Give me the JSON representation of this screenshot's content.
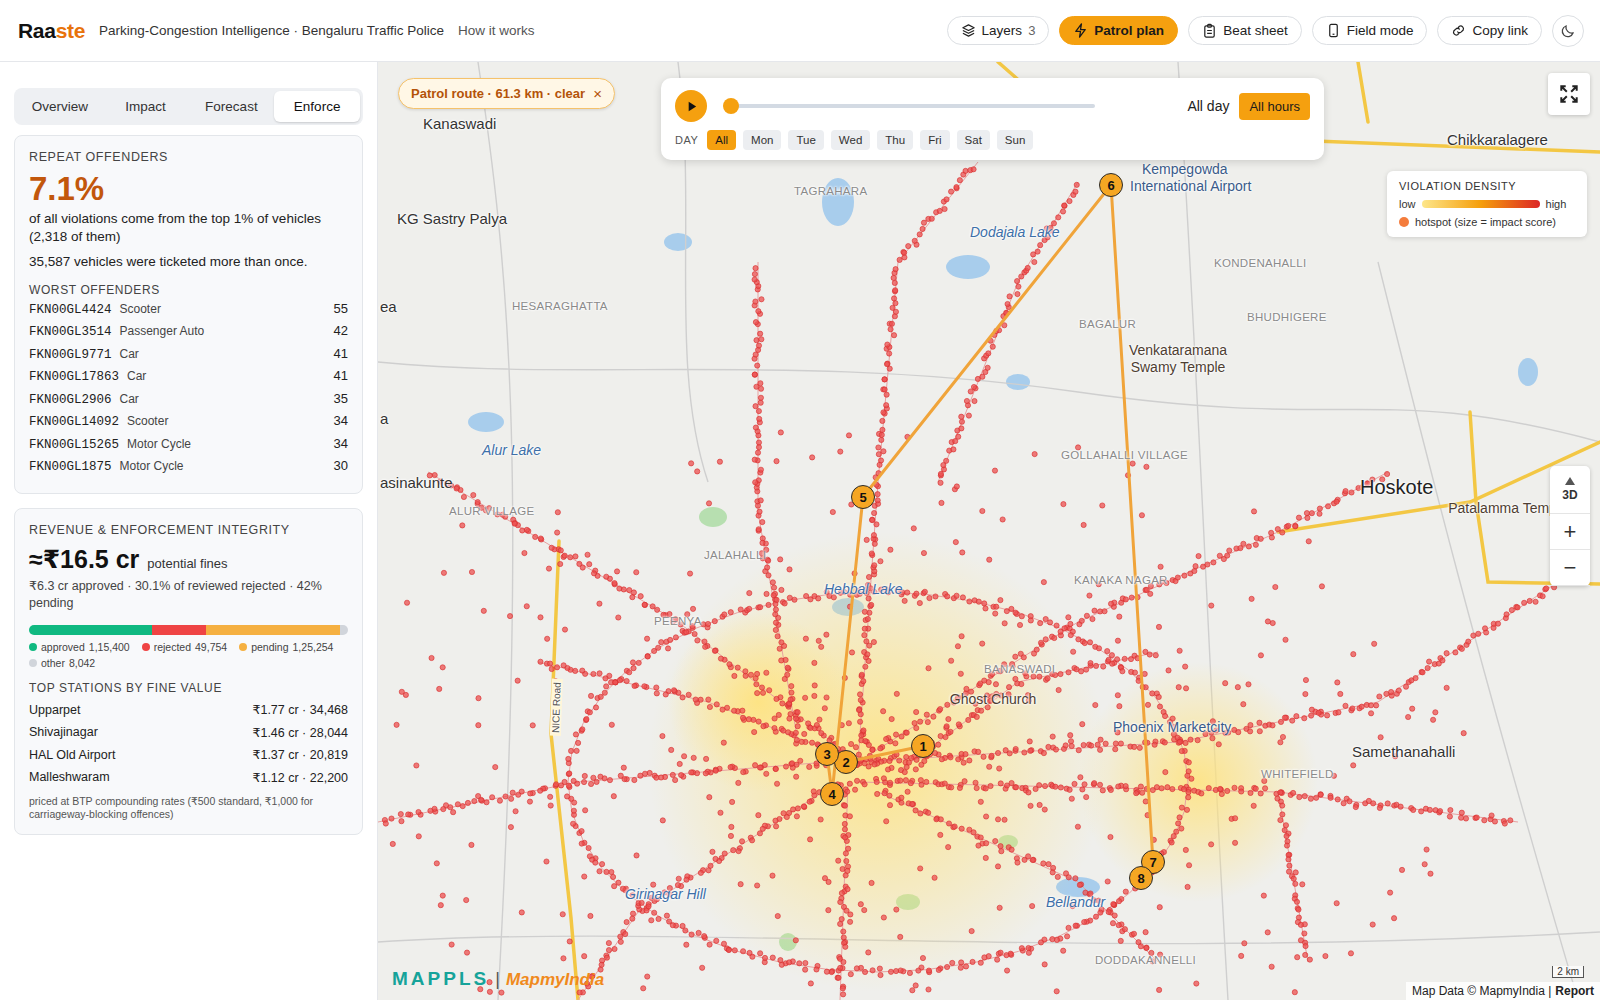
{
  "header": {
    "logo_a": "Raa",
    "logo_b": "ste",
    "subtitle": "Parking-Congestion Intelligence · Bengaluru Traffic Police",
    "how_link": "How it works",
    "buttons": [
      {
        "label": "Layers",
        "badge": "3",
        "selected": false
      },
      {
        "label": "Patrol plan",
        "badge": "",
        "selected": true
      },
      {
        "label": "Beat sheet",
        "badge": "",
        "selected": false
      },
      {
        "label": "Field mode",
        "badge": "",
        "selected": false
      },
      {
        "label": "Copy link",
        "badge": "",
        "selected": false
      }
    ]
  },
  "tabs": [
    {
      "label": "Overview",
      "selected": false
    },
    {
      "label": "Impact",
      "selected": false
    },
    {
      "label": "Forecast",
      "selected": false
    },
    {
      "label": "Enforce",
      "selected": true
    }
  ],
  "repeat": {
    "heading": "REPEAT OFFENDERS",
    "value": "7.1%",
    "desc": "of all violations come from the top 1% of vehicles (2,318 of them)",
    "note": "35,587 vehicles were ticketed more than once.",
    "list_heading": "WORST OFFENDERS",
    "offenders": [
      {
        "plate": "FKN00GL4424",
        "type": "Scooter",
        "count": "55"
      },
      {
        "plate": "FKN00GL3514",
        "type": "Passenger Auto",
        "count": "42"
      },
      {
        "plate": "FKN00GL9771",
        "type": "Car",
        "count": "41"
      },
      {
        "plate": "FKN00GL17863",
        "type": "Car",
        "count": "41"
      },
      {
        "plate": "FKN00GL2906",
        "type": "Car",
        "count": "35"
      },
      {
        "plate": "FKN00GL14092",
        "type": "Scooter",
        "count": "34"
      },
      {
        "plate": "FKN00GL15265",
        "type": "Motor Cycle",
        "count": "34"
      },
      {
        "plate": "FKN00GL1875",
        "type": "Motor Cycle",
        "count": "30"
      }
    ]
  },
  "revenue": {
    "heading": "REVENUE & ENFORCEMENT INTEGRITY",
    "value": "≈₹16.5 cr",
    "value_note": "potential fines",
    "summary": "₹6.3 cr approved · 30.1% of reviewed rejected · 42% pending",
    "segments": [
      {
        "label": "approved",
        "count": "1,15,400",
        "level": 0.387,
        "color": "#10b981"
      },
      {
        "label": "rejected",
        "count": "49,754",
        "level": 0.167,
        "color": "#ef4444"
      },
      {
        "label": "pending",
        "count": "1,25,254",
        "level": 0.42,
        "color": "#f5b041"
      },
      {
        "label": "other",
        "count": "8,042",
        "level": 0.026,
        "color": "#d1d5db"
      }
    ],
    "stations_heading": "TOP STATIONS BY FINE VALUE",
    "stations": [
      {
        "name": "Upparpet",
        "value": "₹1.77 cr · 34,468"
      },
      {
        "name": "Shivajinagar",
        "value": "₹1.46 cr · 28,044"
      },
      {
        "name": "HAL Old Airport",
        "value": "₹1.37 cr · 20,819"
      },
      {
        "name": "Malleshwaram",
        "value": "₹1.12 cr · 22,200"
      }
    ],
    "footnote": "priced at BTP compounding rates (₹500 standard, ₹1,000 for carriageway-blocking offences)"
  },
  "map": {
    "route_chip": {
      "label": "Patrol route · 61.3 km · clear",
      "close": "×"
    },
    "timeline": {
      "level": 0,
      "range_label": "All day",
      "hours_button": "All hours",
      "hours_selected": true,
      "day_label": "DAY",
      "days": [
        {
          "label": "All",
          "selected": true
        },
        {
          "label": "Mon",
          "selected": false
        },
        {
          "label": "Tue",
          "selected": false
        },
        {
          "label": "Wed",
          "selected": false
        },
        {
          "label": "Thu",
          "selected": false
        },
        {
          "label": "Fri",
          "selected": false
        },
        {
          "label": "Sat",
          "selected": false
        },
        {
          "label": "Sun",
          "selected": false
        }
      ]
    },
    "legend": {
      "title": "VIOLATION DENSITY",
      "low": "low",
      "high": "high",
      "hotspot": "hotspot (size = impact score)"
    },
    "controls": {
      "three_d": "3D",
      "zoom_in": "+",
      "zoom_out": "−"
    },
    "stops": [
      {
        "label": "1"
      },
      {
        "label": "2"
      },
      {
        "label": "3"
      },
      {
        "label": "4"
      },
      {
        "label": "5"
      },
      {
        "label": "6"
      },
      {
        "label": "7"
      },
      {
        "label": "8"
      }
    ],
    "labels": [
      {
        "text": "Kanaswadi",
        "kind": "town"
      },
      {
        "text": "KG Sastry Palya",
        "kind": "town"
      },
      {
        "text": "TAGRAHARA",
        "kind": "area"
      },
      {
        "text": "Kempegowda",
        "kind": "airport"
      },
      {
        "text": "International Airport",
        "kind": "airport"
      },
      {
        "text": "Dodajala Lake",
        "kind": "water"
      },
      {
        "text": "Chikkaralagere",
        "kind": "town"
      },
      {
        "text": "KONDENAHALLI",
        "kind": "area"
      },
      {
        "text": "HESARAGHATTA",
        "kind": "area"
      },
      {
        "text": "BAGALUR",
        "kind": "area"
      },
      {
        "text": "BHUDHIGERE",
        "kind": "area"
      },
      {
        "text": "Venkataramana Swamy Temple",
        "kind": "poi"
      },
      {
        "text": "ea",
        "kind": "town"
      },
      {
        "text": "a",
        "kind": "town"
      },
      {
        "text": "Alur Lake",
        "kind": "water"
      },
      {
        "text": "asinakunte",
        "kind": "town"
      },
      {
        "text": "ALUR VILLAGE",
        "kind": "area"
      },
      {
        "text": "GOLLAHALLI VILLAGE",
        "kind": "area"
      },
      {
        "text": "Hoskote",
        "kind": "big"
      },
      {
        "text": "Patalamma Temple",
        "kind": "poi"
      },
      {
        "text": "JALAHALLI",
        "kind": "area"
      },
      {
        "text": "Hebbal Lake",
        "kind": "water"
      },
      {
        "text": "PEENYA",
        "kind": "area"
      },
      {
        "text": "KANAKA NAGAR",
        "kind": "area"
      },
      {
        "text": "BANASWADI",
        "kind": "area"
      },
      {
        "text": "Ghost Church",
        "kind": "poi"
      },
      {
        "text": "Phoenix Marketcity",
        "kind": "airport"
      },
      {
        "text": "Samethanahalli",
        "kind": "town"
      },
      {
        "text": "WHITEFIELD",
        "kind": "area"
      },
      {
        "text": "Girinagar Hill",
        "kind": "water"
      },
      {
        "text": "Bellandur",
        "kind": "water"
      },
      {
        "text": "DODDAKANNELLI",
        "kind": "area"
      },
      {
        "text": "NICE Road",
        "kind": "road"
      }
    ],
    "brand": {
      "a": "MAPPLS",
      "sep": "|",
      "b": "MapmyIndia"
    },
    "attribution": "Map Data © MapmyIndia |",
    "report": "Report",
    "scale": "2 km"
  }
}
